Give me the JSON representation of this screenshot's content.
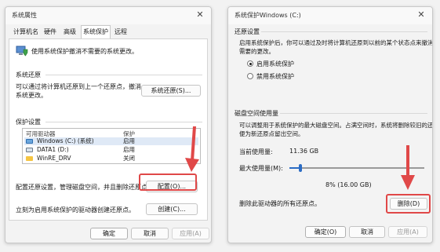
{
  "left_window": {
    "title": "系统属性",
    "close_glyph": "✕",
    "tabs": [
      {
        "label": "计算机名"
      },
      {
        "label": "硬件"
      },
      {
        "label": "高级"
      },
      {
        "label": "系统保护"
      },
      {
        "label": "远程"
      }
    ],
    "active_tab": "系统保护",
    "intro": "使用系统保护撤消不需要的系统更改。",
    "restore": {
      "heading": "系统还原",
      "desc_line1": "可以通过将计算机还原到上一个还原点，撤消",
      "desc_line2": "系统更改。",
      "button": "系统还原(S)..."
    },
    "protection": {
      "heading": "保护设置",
      "col_drive": "可用驱动器",
      "col_protect": "保护",
      "drives": [
        {
          "name": "Windows (C:) (系统)",
          "status": "启用"
        },
        {
          "name": "DATA1 (D:)",
          "status": "启用"
        },
        {
          "name": "WinRE_DRV",
          "status": "关闭"
        }
      ],
      "config_text": "配置还原设置，管理磁盘空间，并且删除还原点。",
      "config_button": "配置(O)...",
      "create_text": "立刻为启用系统保护的驱动器创建还原点。",
      "create_button": "创建(C)..."
    },
    "footer": {
      "ok": "确定",
      "cancel": "取消",
      "apply": "应用(A)"
    }
  },
  "right_window": {
    "title": "系统保护Windows (C:)",
    "close_glyph": "✕",
    "restore_settings": {
      "heading": "还原设置",
      "desc_line1": "启用系统保护后，你可以通过及时将计算机还原到以前的某个状态点来撤消不",
      "desc_line2": "需要的更改。",
      "option_on": "启用系统保护",
      "option_off": "禁用系统保护",
      "selected": "启用系统保护"
    },
    "disk_usage": {
      "heading": "磁盘空间使用量",
      "desc_line1": "可以调整用于系统保护的最大磁盘空间。占满空间时，系统将删除较旧的还原点以",
      "desc_line2": "便为新还原点留出空间。",
      "current_label": "当前使用量:",
      "current_value": "11.36 GB",
      "max_label": "最大使用量(M):",
      "max_percent": 8,
      "max_value": "8% (16.00 GB)",
      "delete_text": "删除此驱动器的所有还原点。",
      "delete_button": "删除(D)"
    },
    "footer": {
      "ok": "确定(O)",
      "cancel": "取消",
      "apply": "应用(A)"
    }
  },
  "annotations": {
    "highlight_color": "#e04848"
  }
}
